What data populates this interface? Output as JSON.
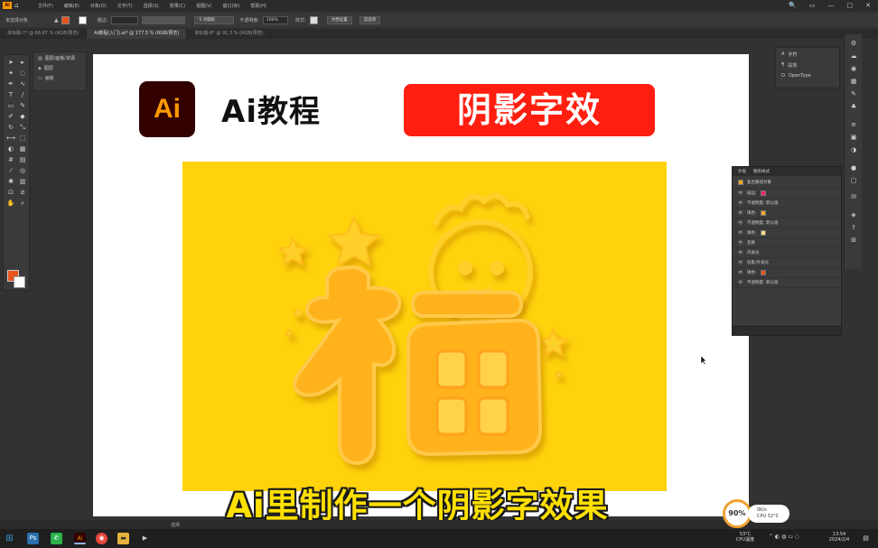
{
  "menubar": {
    "app_logo": "Ai",
    "items": [
      "文件(F)",
      "编辑(E)",
      "对象(O)",
      "文字(T)",
      "选择(S)",
      "效果(C)",
      "视图(V)",
      "窗口(W)",
      "帮助(H)"
    ],
    "window_controls": [
      "🔍",
      "▭",
      "—",
      "□",
      "✕"
    ]
  },
  "controlbar": {
    "selection_label": "未选择对象",
    "stroke_label": "描边:",
    "stroke_profile": "5 点圆形",
    "opacity_label": "不透明度:",
    "opacity_value": "100%",
    "style_label": "样式:",
    "doc_setup_button": "文档设置",
    "preferences_button": "首选项"
  },
  "tabs": [
    {
      "label": "未标题-7* @ 66.67 % (RGB/预览)",
      "active": false
    },
    {
      "label": "Ai教程(入门).ai* @ 177.5 % (RGB/预览)",
      "active": true
    },
    {
      "label": "未标题-8* @ 91.3 % (RGB/预览)",
      "active": false
    }
  ],
  "layers_panel": {
    "items": [
      "图层/画板/资源",
      "图层",
      "画板"
    ]
  },
  "character_panel": {
    "items": [
      "字符",
      "段落",
      "OpenType"
    ]
  },
  "artboard": {
    "logo_text": "Ai",
    "title": "Ai教程",
    "banner": "阴影字效"
  },
  "appearance_panel": {
    "tabs": [
      "外观",
      "图形样式"
    ],
    "header_object": "复合路径对象",
    "rows": [
      {
        "label": "描边:",
        "swatch": "#ff2060"
      },
      {
        "label": "不透明度: 默认值",
        "swatch": ""
      },
      {
        "label": "填色:",
        "swatch": "#f5a623"
      },
      {
        "label": "不透明度: 默认值",
        "swatch": ""
      },
      {
        "label": "填色:",
        "swatch": "#ffe082"
      },
      {
        "label": "变换",
        "swatch": ""
      },
      {
        "label": "内发光",
        "swatch": ""
      },
      {
        "label": "投影/外发光",
        "swatch": ""
      },
      {
        "label": "填色:",
        "swatch": "#e8541b"
      },
      {
        "label": "不透明度: 默认值",
        "swatch": ""
      }
    ]
  },
  "subtitle": "Ai里制作一个阴影字效果",
  "statusbar": {
    "zoom": "选择"
  },
  "perf_widget": {
    "percent": "90%",
    "upload": "0K/s",
    "download": "0K/s",
    "cpu_temp": "CPU 52°C"
  },
  "taskbar": {
    "weather_temp": "53°C",
    "weather_label": "CPU温度",
    "time": "13:54",
    "date": "2024/2/4"
  },
  "colors": {
    "accent_red": "#ff1e0f",
    "art_yellow": "#ffd20c",
    "subtitle_yellow": "#ffe000",
    "ai_brand_dark": "#330000",
    "ai_brand_orange": "#ff9a00"
  }
}
